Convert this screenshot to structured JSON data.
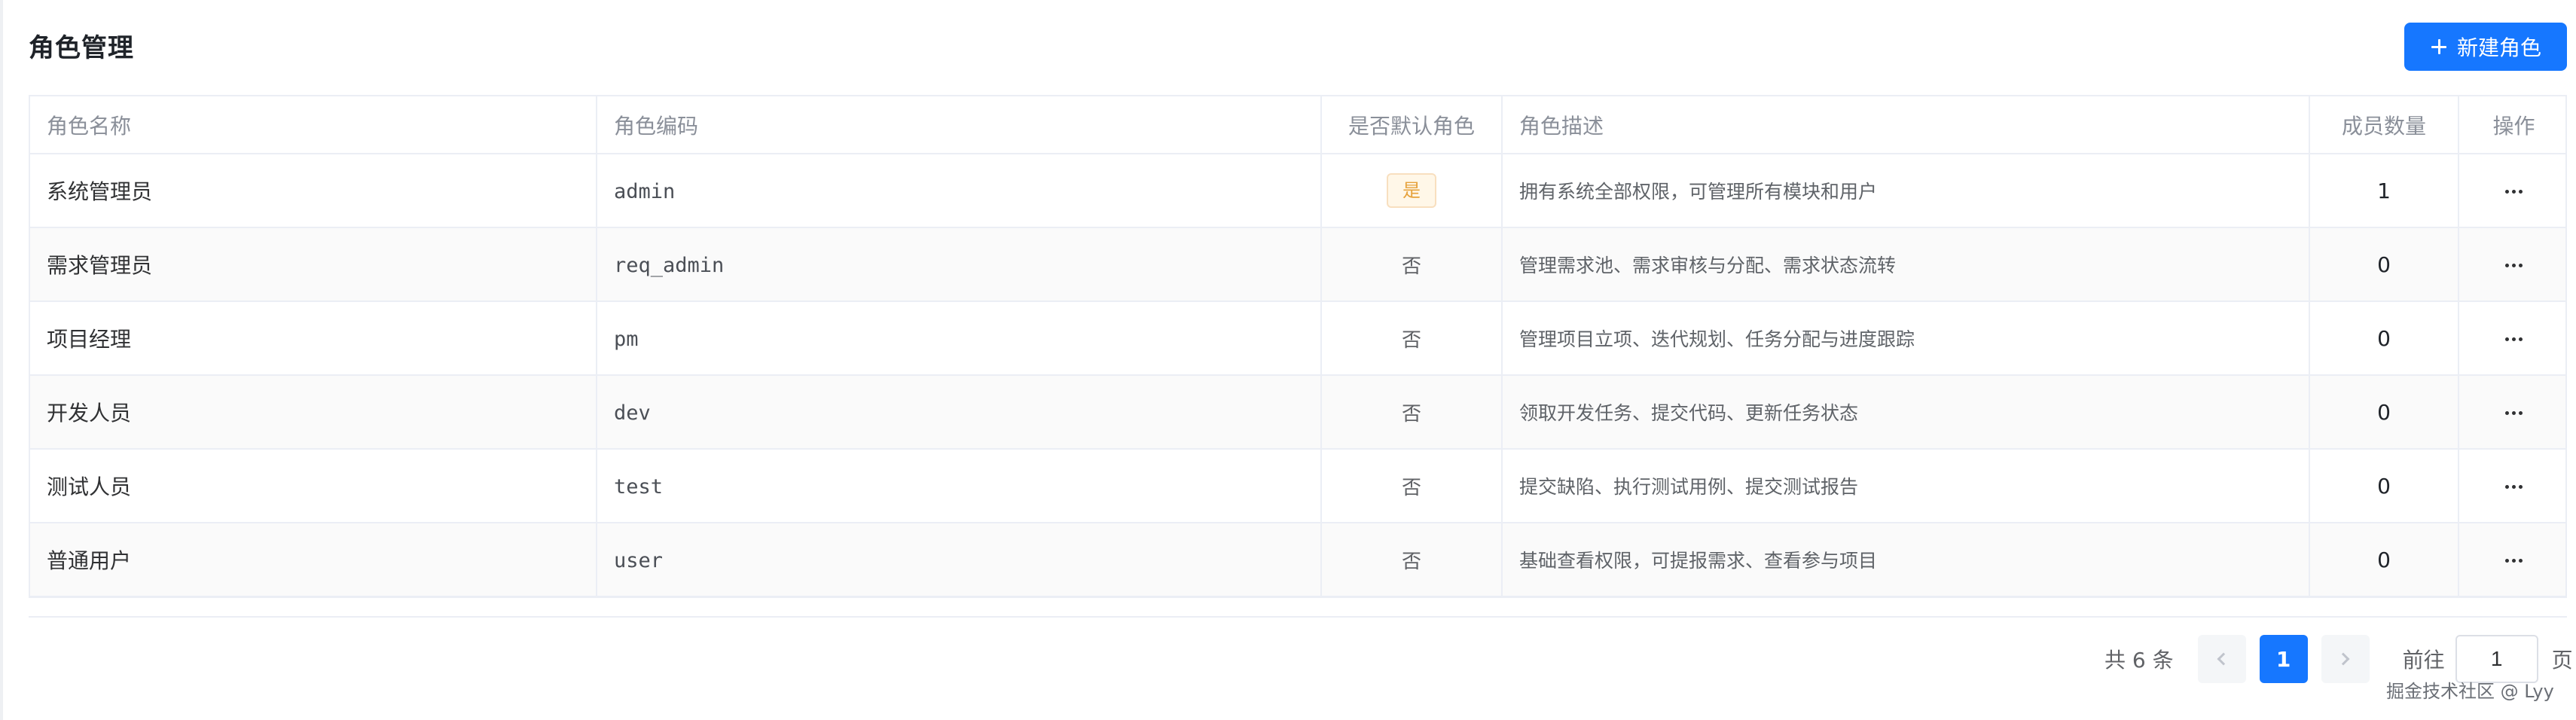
{
  "page": {
    "title": "角色管理"
  },
  "toolbar": {
    "new_role_label": "新建角色",
    "new_role_icon": "plus-icon"
  },
  "table": {
    "columns": {
      "role_name": "角色名称",
      "role_code": "角色编码",
      "is_default": "是否默认角色",
      "description": "角色描述",
      "member_count": "成员数量",
      "actions": "操作"
    },
    "rows": [
      {
        "name": "系统管理员",
        "code": "admin",
        "is_default": "是",
        "default_style": "tag",
        "description": "拥有系统全部权限，可管理所有模块和用户",
        "member_count": "1",
        "action_icon": "more-icon"
      },
      {
        "name": "需求管理员",
        "code": "req_admin",
        "is_default": "否",
        "default_style": "text",
        "description": "管理需求池、需求审核与分配、需求状态流转",
        "member_count": "0",
        "action_icon": "more-icon"
      },
      {
        "name": "项目经理",
        "code": "pm",
        "is_default": "否",
        "default_style": "text",
        "description": "管理项目立项、迭代规划、任务分配与进度跟踪",
        "member_count": "0",
        "action_icon": "more-icon"
      },
      {
        "name": "开发人员",
        "code": "dev",
        "is_default": "否",
        "default_style": "text",
        "description": "领取开发任务、提交代码、更新任务状态",
        "member_count": "0",
        "action_icon": "more-icon"
      },
      {
        "name": "测试人员",
        "code": "test",
        "is_default": "否",
        "default_style": "text",
        "description": "提交缺陷、执行测试用例、提交测试报告",
        "member_count": "0",
        "action_icon": "more-icon"
      },
      {
        "name": "普通用户",
        "code": "user",
        "is_default": "否",
        "default_style": "text",
        "description": "基础查看权限，可提报需求、查看参与项目",
        "member_count": "0",
        "action_icon": "more-icon"
      }
    ]
  },
  "pagination": {
    "total_text": "共 6 条",
    "current_page": "1",
    "goto_label": "前往",
    "input_value": "1",
    "page_suffix": "页",
    "prev_icon": "chevron-left-icon",
    "next_icon": "chevron-right-icon"
  },
  "watermark": {
    "text": "掘金技术社区 @ Lyy"
  },
  "colors": {
    "primary": "#1677ff",
    "border": "#ebeef5",
    "header_text": "#8a8f99",
    "tag_background": "#fff7e8",
    "tag_border": "#f8dfbf",
    "tag_text": "#e6a23c"
  }
}
